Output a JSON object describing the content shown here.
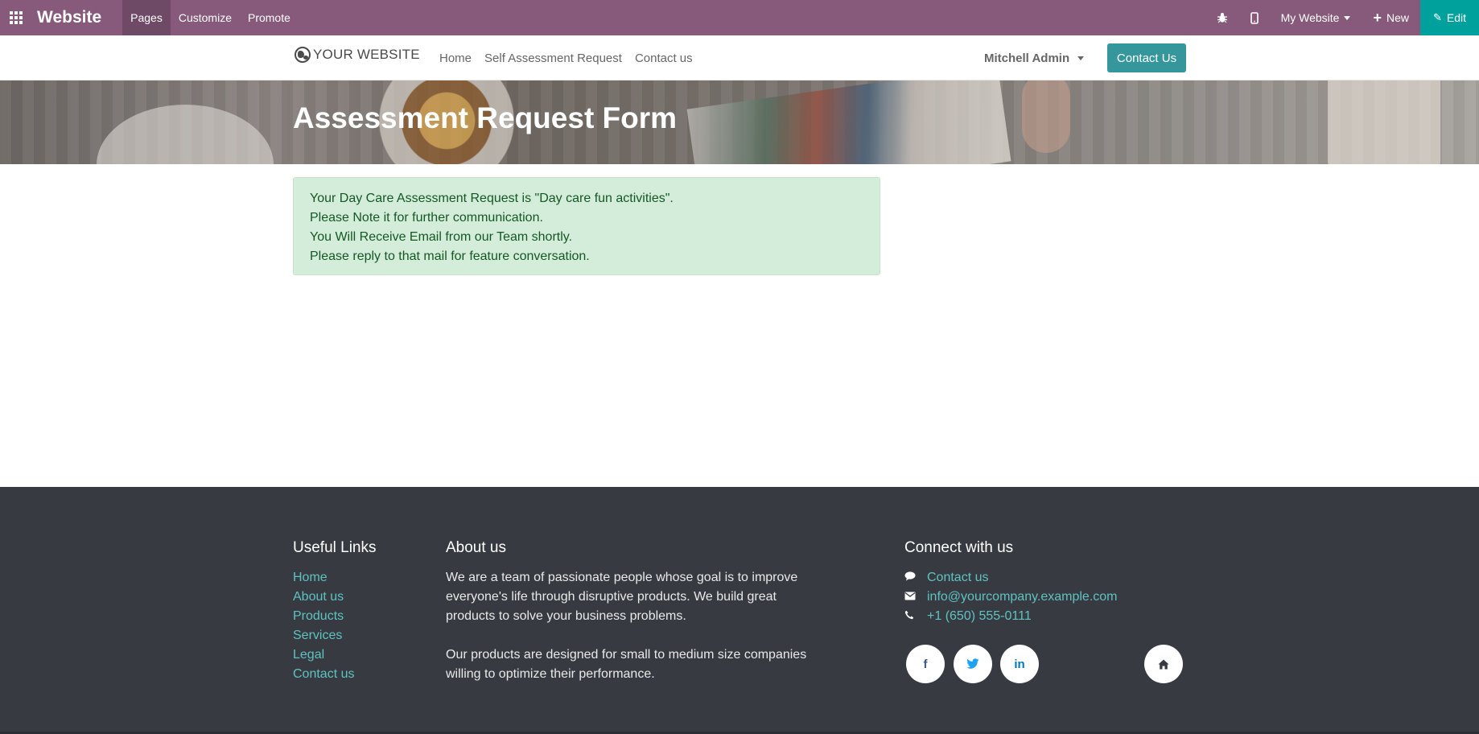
{
  "topbar": {
    "brand": "Website",
    "menu": [
      "Pages",
      "Customize",
      "Promote"
    ],
    "website_selector": "My Website",
    "new_label": "New",
    "edit_label": "Edit"
  },
  "site_header": {
    "logo_text": "YOUR WEBSITE",
    "nav": [
      "Home",
      "Self Assessment Request",
      "Contact us"
    ],
    "user_name": "Mitchell Admin",
    "contact_button": "Contact Us"
  },
  "banner": {
    "title": "Assessment Request Form"
  },
  "alert": {
    "lines": [
      "Your Day Care Assessment Request is \"Day care fun activities\".",
      "Please Note it for further communication.",
      "You Will Receive Email from our Team shortly.",
      "Please reply to that mail for feature conversation."
    ]
  },
  "footer": {
    "useful_links": {
      "heading": "Useful Links",
      "links": [
        "Home",
        "About us",
        "Products",
        "Services",
        "Legal",
        "Contact us"
      ]
    },
    "about": {
      "heading": "About us",
      "paragraphs": [
        "We are a team of passionate people whose goal is to improve everyone's life through disruptive products. We build great products to solve your business problems.",
        "Our products are designed for small to medium size companies willing to optimize their performance."
      ]
    },
    "connect": {
      "heading": "Connect with us",
      "contact_link": "Contact us",
      "email": "info@yourcompany.example.com",
      "phone": "+1 (650) 555-0111",
      "socials": [
        {
          "name": "facebook-icon",
          "glyph": "f",
          "color": "#3b5998"
        },
        {
          "name": "twitter-icon",
          "glyph": "🐦",
          "color": "#1da1f2"
        },
        {
          "name": "linkedin-icon",
          "glyph": "in",
          "color": "#0077b5"
        },
        {
          "name": "home-icon",
          "glyph": "⌂",
          "color": "#373b41"
        }
      ]
    }
  },
  "colors": {
    "topbar": "#875a7b",
    "edit_button": "#00a09d",
    "contact_button": "#35979c",
    "footer_bg": "#373b41",
    "footer_link": "#5fc2c2",
    "alert_bg": "#d4edda",
    "alert_text": "#155724"
  }
}
